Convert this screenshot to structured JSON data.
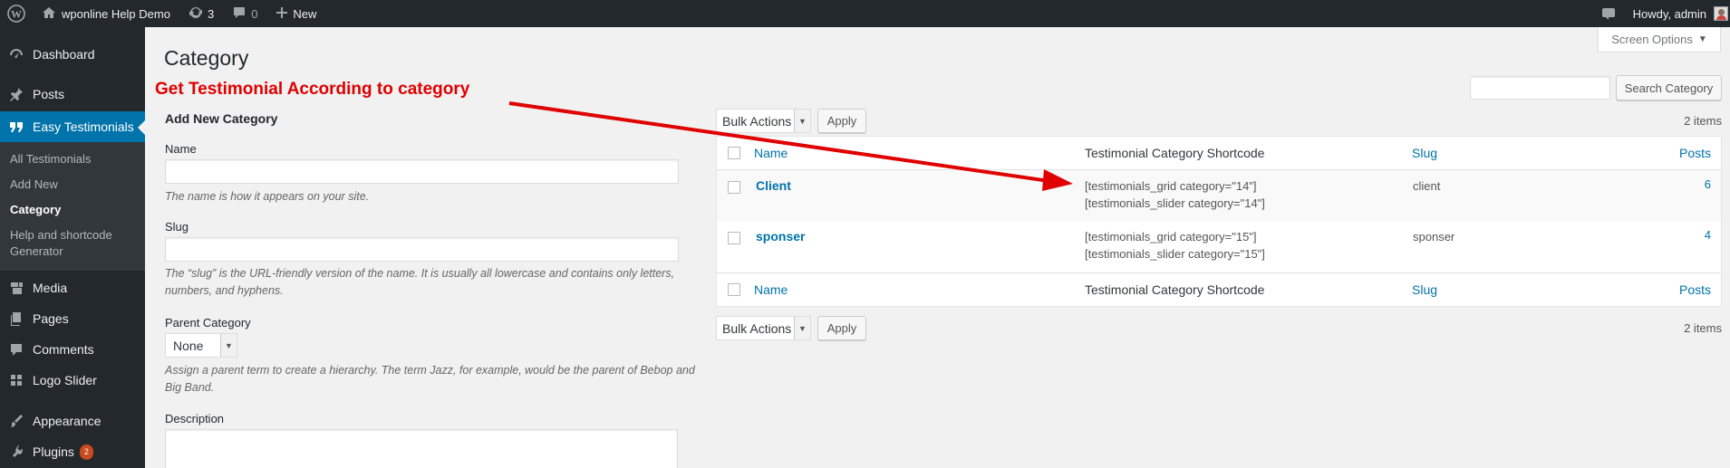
{
  "adminbar": {
    "site_name": "wponline Help Demo",
    "updates_count": "3",
    "comments_count": "0",
    "new_label": "New",
    "greeting": "Howdy, admin"
  },
  "sidebar": {
    "items": [
      {
        "label": "Dashboard",
        "icon": "dashboard-icon"
      },
      {
        "label": "Posts",
        "icon": "pin-icon"
      },
      {
        "label": "Easy Testimonials",
        "icon": "quote-icon"
      },
      {
        "label": "Media",
        "icon": "media-icon"
      },
      {
        "label": "Pages",
        "icon": "pages-icon"
      },
      {
        "label": "Comments",
        "icon": "comment-icon"
      },
      {
        "label": "Logo Slider",
        "icon": "grid-icon"
      },
      {
        "label": "Appearance",
        "icon": "brush-icon"
      },
      {
        "label": "Plugins",
        "icon": "plugin-icon",
        "badge": "2"
      }
    ],
    "submenu": [
      "All Testimonials",
      "Add New",
      "Category",
      "Help and shortcode Generator"
    ],
    "active_color": "#0073aa"
  },
  "page": {
    "title": "Category",
    "screen_options": "Screen Options",
    "search_button": "Search Category",
    "search_value": ""
  },
  "annotation": {
    "text": "Get Testimonial According to category",
    "color": "#e00000"
  },
  "form": {
    "heading": "Add New Category",
    "name_label": "Name",
    "name_value": "",
    "name_desc": "The name is how it appears on your site.",
    "slug_label": "Slug",
    "slug_value": "",
    "slug_desc_1": "The “slug” is the URL-friendly version of the name. It is usually all lowercase and contains only letters,",
    "slug_desc_2": "numbers, and hyphens.",
    "parent_label": "Parent Category",
    "parent_value": "None",
    "parent_desc_1": "Assign a parent term to create a hierarchy. The term Jazz, for example, would be the parent of Bebop and",
    "parent_desc_2": "Big Band.",
    "description_label": "Description",
    "description_value": ""
  },
  "list": {
    "bulk_actions": "Bulk Actions",
    "apply": "Apply",
    "items_count": "2 items",
    "columns": {
      "name": "Name",
      "shortcode": "Testimonial Category Shortcode",
      "slug": "Slug",
      "posts": "Posts"
    },
    "rows": [
      {
        "name": "Client",
        "shortcode_1": "[testimonials_grid category=\"14\"]",
        "shortcode_2": "[testimonials_slider category=\"14\"]",
        "slug": "client",
        "posts": "6"
      },
      {
        "name": "sponser",
        "shortcode_1": "[testimonials_grid category=\"15\"]",
        "shortcode_2": "[testimonials_slider category=\"15\"]",
        "slug": "sponser",
        "posts": "4"
      }
    ]
  }
}
